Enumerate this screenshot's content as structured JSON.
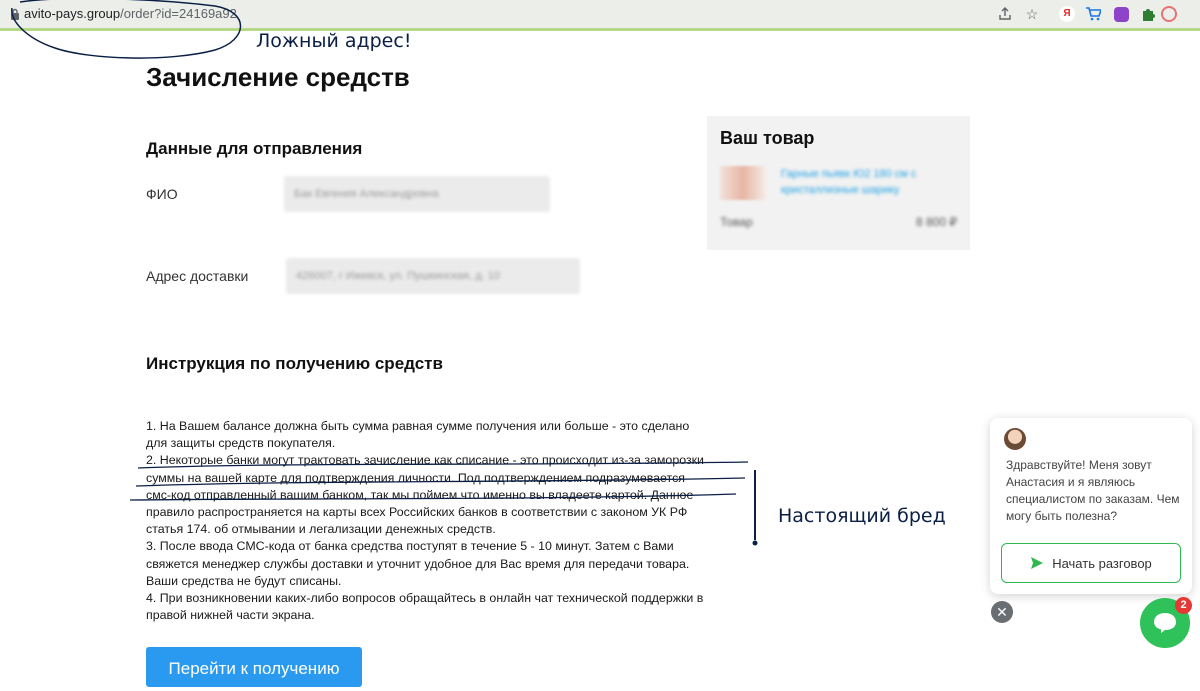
{
  "browser": {
    "url_domain": "avito-pays.group",
    "url_path": "/order?id=24169a92",
    "icons": [
      "share-icon",
      "star-icon",
      "yandex-icon",
      "cart-icon",
      "extension-icon",
      "puzzle-icon",
      "profile-icon"
    ]
  },
  "annotations": {
    "fake_address": "Ложный адрес!",
    "nonsense": "Настоящий бред"
  },
  "page": {
    "title": "Зачисление средств",
    "shipping_section_title": "Данные для отправления",
    "name_label": "ФИО",
    "name_value": "Бак Евгения Александровна",
    "address_label": "Адрес доставки",
    "address_value": "426007, г Ижевск, ул. Пушкинская, д. 10",
    "instructions_title": "Инструкция по получению средств",
    "instructions": [
      "1. На Вашем балансе должна быть сумма равная сумме получения или больше - это сделано для защиты средств покупателя.",
      "2. Некоторые банки могут трактовать зачисление как списание - это происходит из-за заморозки суммы на вашей карте для подтверждения личности. Под подтверждением подразумевается смс-код отправленный вашим банком, так мы поймем что именно вы владеете картой. Данное правило распространяется на карты всех Российских банков в соответствии с законом УК РФ статья 174. об отмывании и легализации денежных средств.",
      "3. После ввода СМС-кода от банка средства поступят в течение 5 - 10 минут. Затем с Вами свяжется менеджер службы доставки и уточнит удобное для Вас время для передачи товара. Ваши средства не будут списаны.",
      "4. При возникновении каких-либо вопросов обращайтесь в онлайн чат технической поддержки в правой нижней части экрана."
    ],
    "cta_label": "Перейти к получению"
  },
  "product_card": {
    "title": "Ваш товар",
    "product_name": "Гарные пьявк Ю2 180 см с кристаллизные шарику",
    "row_label": "Товар",
    "row_value": "8 800 ₽"
  },
  "chat": {
    "message": "Здравствуйте! Меня зовут Анастасия и я являюсь специалистом по заказам. Чем могу быть полезна?",
    "start_button": "Начать разговор",
    "close_symbol": "✕",
    "badge_count": "2"
  },
  "colors": {
    "accent_blue": "#2a9af0",
    "chat_green": "#2fc15a",
    "annotation_ink": "#0b1f45",
    "badge_red": "#e53935"
  }
}
